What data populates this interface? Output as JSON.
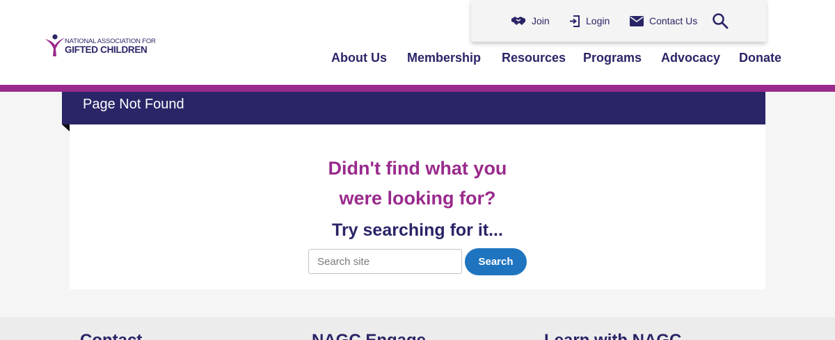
{
  "logo": {
    "line1": "NATIONAL ASSOCIATION FOR",
    "line2": "GIFTED CHILDREN",
    "colors": {
      "magenta": "#992a8c",
      "navy": "#2a2567"
    }
  },
  "utility_nav": {
    "join": {
      "label": "Join",
      "icon": "handshake-icon"
    },
    "login": {
      "label": "Login",
      "icon": "login-icon"
    },
    "contact": {
      "label": "Contact Us",
      "icon": "envelope-icon"
    },
    "search_icon": "search-icon"
  },
  "main_nav": [
    "About Us",
    "Membership",
    "Resources",
    "Programs",
    "Advocacy",
    "Donate"
  ],
  "page": {
    "title": "Page Not Found",
    "heading_line1": "Didn't find what you",
    "heading_line2": "were looking for?",
    "subheading": "Try searching for it...",
    "search_placeholder": "Search site",
    "search_value": "",
    "search_button": "Search"
  },
  "footer": {
    "columns": [
      "Contact",
      "NAGC Engage",
      "Learn with NAGC"
    ]
  },
  "colors": {
    "accent_purple": "#992a8c",
    "navy": "#2a2567",
    "button_blue": "#1f74c0",
    "page_bg": "#f5f5f5"
  }
}
